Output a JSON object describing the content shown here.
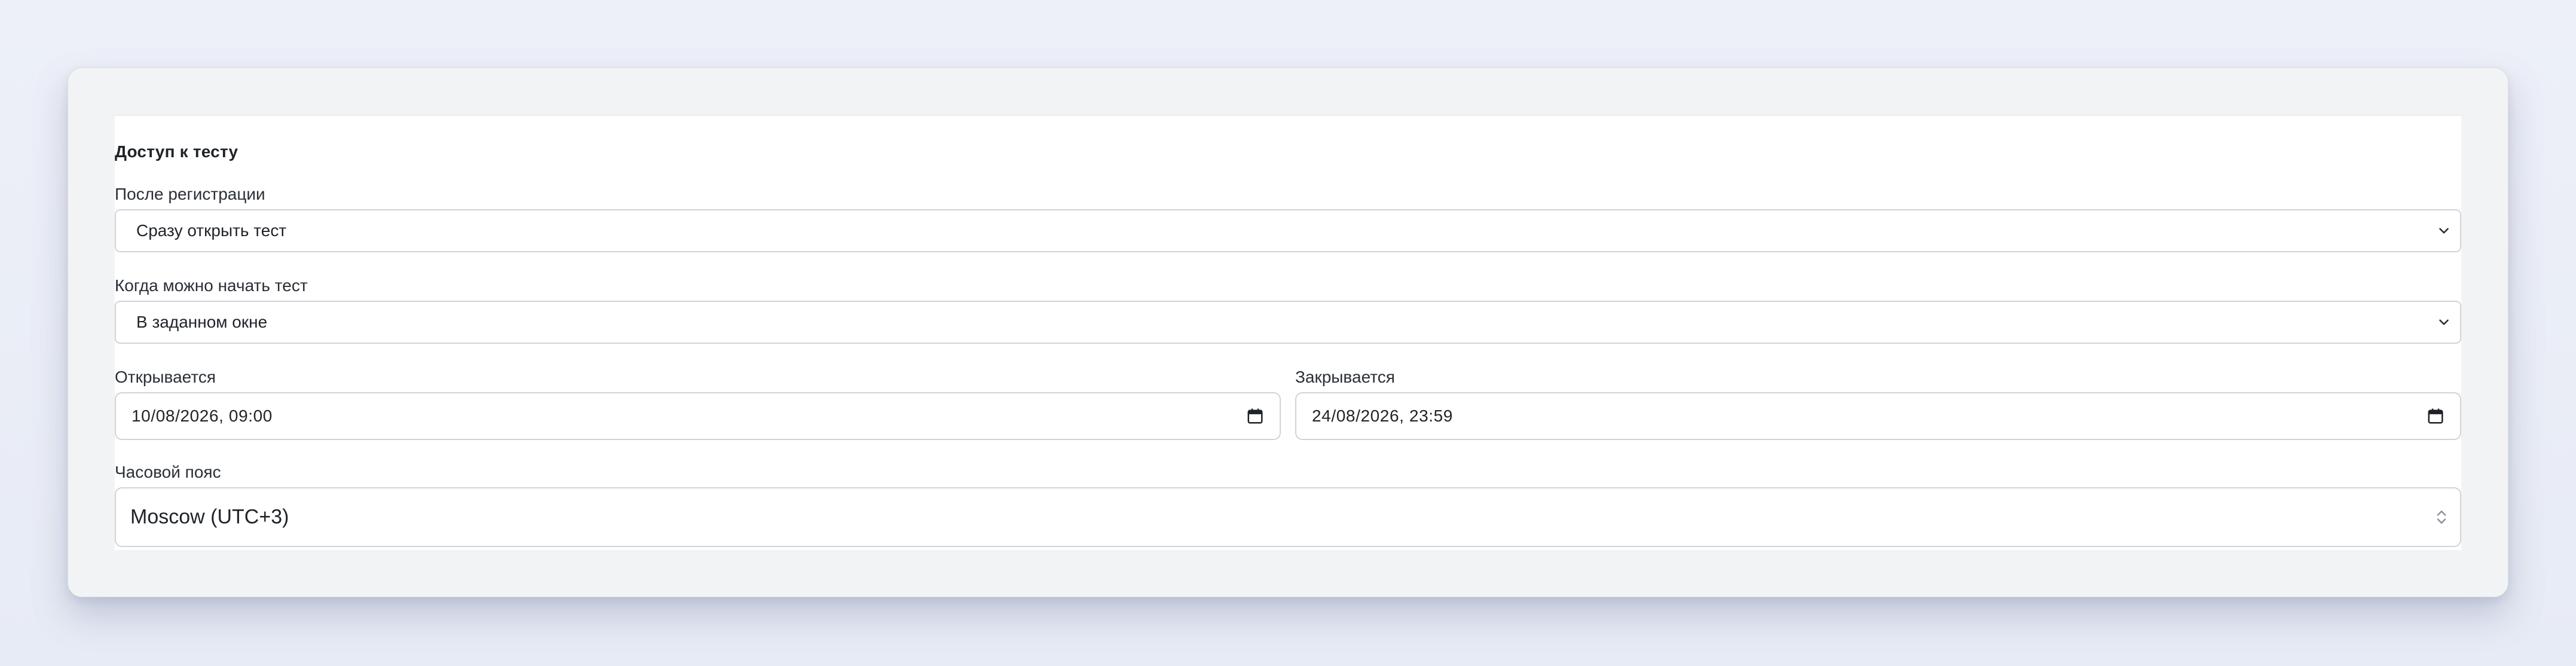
{
  "section": {
    "title": "Доступ к тесту"
  },
  "after_registration": {
    "label": "После регистрации",
    "value": "Сразу открыть тест",
    "icon": "chevron-down-icon"
  },
  "start_mode": {
    "label": "Когда можно начать тест",
    "value": "В заданном окне",
    "icon": "chevron-down-icon"
  },
  "opens": {
    "label": "Открывается",
    "value": "10/08/2026, 09:00",
    "icon": "calendar-icon"
  },
  "closes": {
    "label": "Закрывается",
    "value": "24/08/2026, 23:59",
    "icon": "calendar-icon"
  },
  "timezone": {
    "label": "Часовой пояс",
    "value": "Moscow (UTC+3)",
    "icon": "chevron-updown-icon"
  },
  "colors": {
    "page_background": "#e9edf6",
    "card_background": "#f2f3f4",
    "panel_background": "#ffffff",
    "border": "#cfd4da",
    "text": "#1f2329"
  }
}
